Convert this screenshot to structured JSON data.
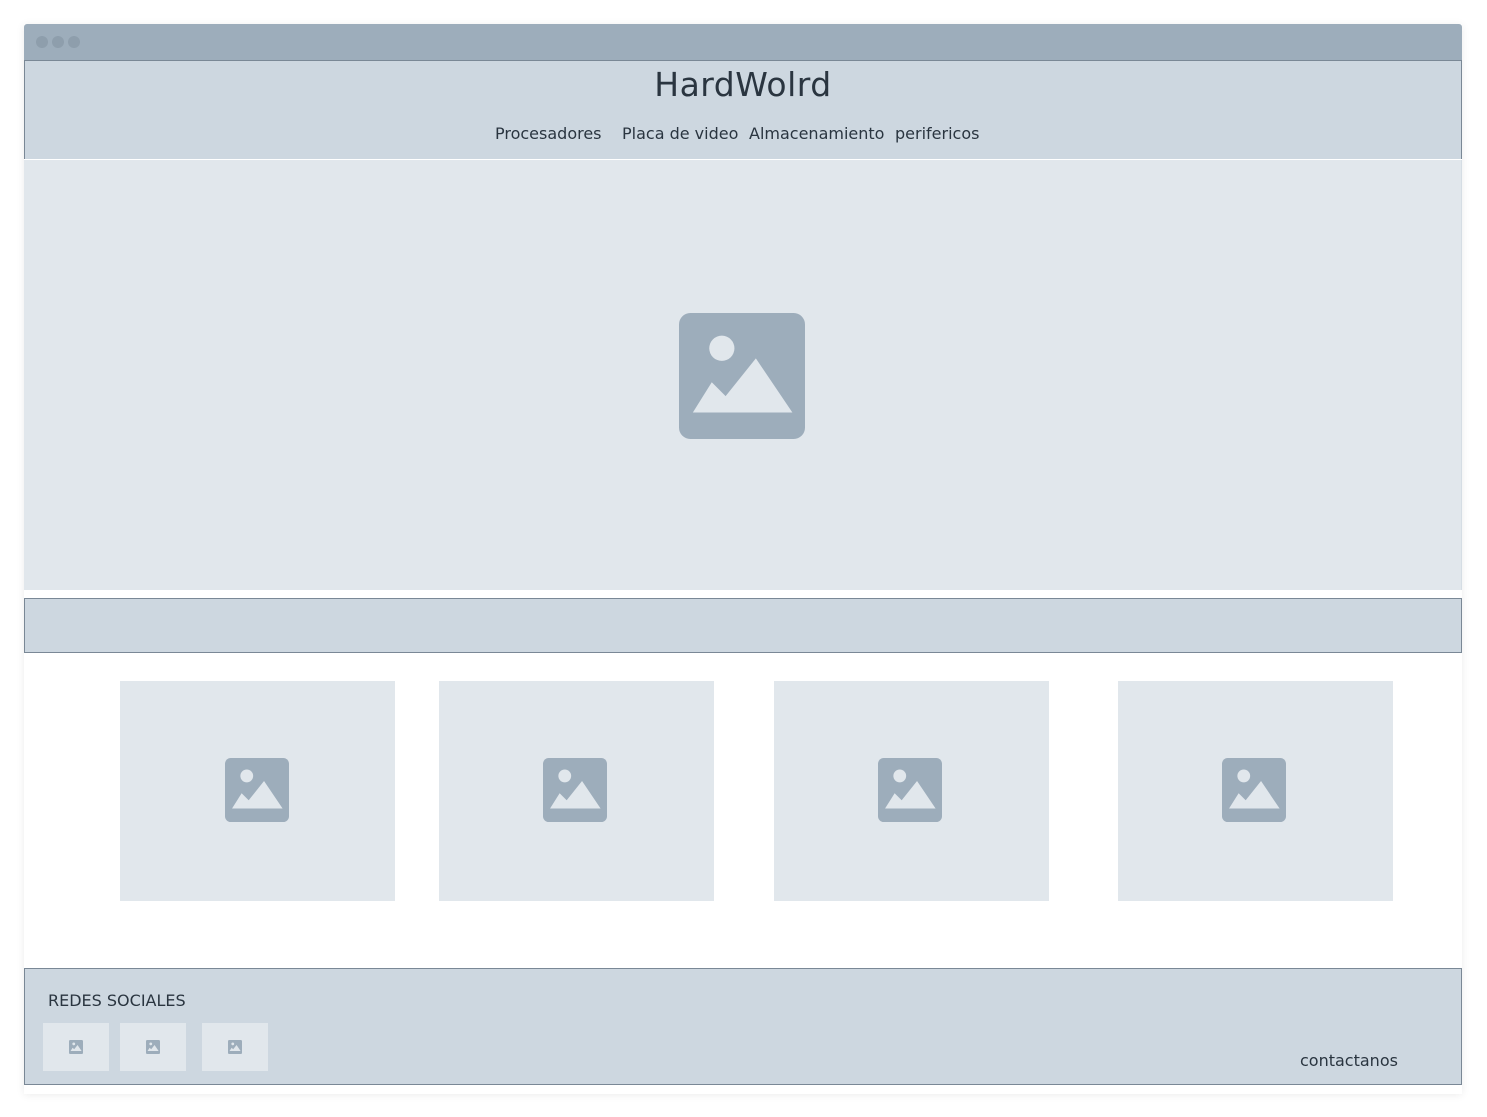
{
  "site": {
    "title": "HardWolrd"
  },
  "nav": {
    "items": [
      {
        "label": "Procesadores"
      },
      {
        "label": "Placa de video"
      },
      {
        "label": "Almacenamiento"
      },
      {
        "label": "perifericos"
      }
    ]
  },
  "hero": {
    "icon": "image-placeholder-icon"
  },
  "cards": [
    {
      "icon": "image-placeholder-icon"
    },
    {
      "icon": "image-placeholder-icon"
    },
    {
      "icon": "image-placeholder-icon"
    },
    {
      "icon": "image-placeholder-icon"
    }
  ],
  "footer": {
    "title": "REDES SOCIALES",
    "social_links": [
      {
        "icon": "image-placeholder-icon"
      },
      {
        "icon": "image-placeholder-icon"
      },
      {
        "icon": "image-placeholder-icon"
      }
    ],
    "contact_label": "contactanos"
  },
  "colors": {
    "window_titlebar": "#9dadbb",
    "header_bg": "#cdd7e0",
    "placeholder_bg": "#e1e7ec",
    "icon": "#9dadbb",
    "text": "#2a3540"
  }
}
